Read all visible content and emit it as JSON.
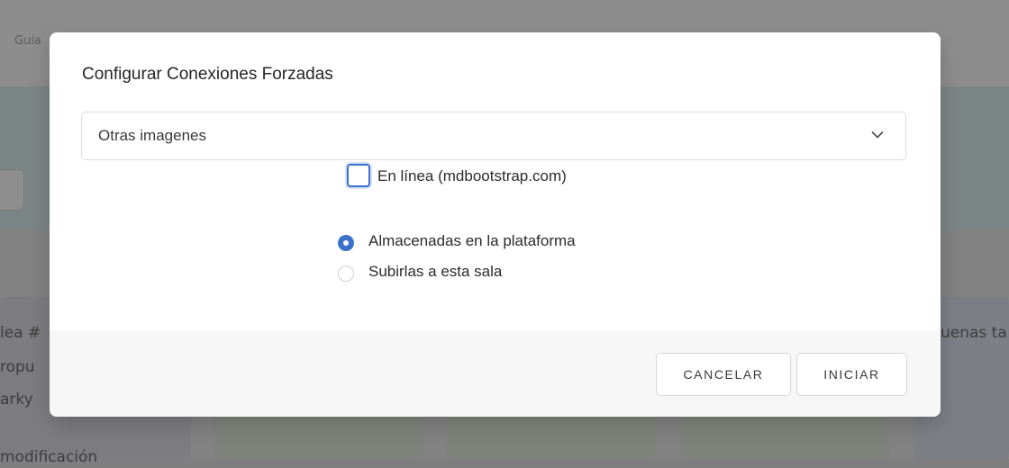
{
  "background": {
    "nav_tab_partial": "Guía",
    "card_texts": [
      "lea #",
      "ropu",
      "arky",
      " modificación",
      "uenas ta"
    ]
  },
  "modal": {
    "title": "Configurar Conexiones Forzadas",
    "select": {
      "value": "Otras imagenes",
      "icon": "chevron-down-icon"
    },
    "checkbox": {
      "label": "En línea (mdbootstrap.com)",
      "checked": false,
      "focused": true
    },
    "radios": [
      {
        "label": "Almacenadas en la plataforma",
        "checked": true
      },
      {
        "label": "Subirlas a esta sala",
        "checked": false
      }
    ],
    "buttons": {
      "cancel": "CANCELAR",
      "start": "INICIAR"
    }
  },
  "colors": {
    "accent": "#3b71ca",
    "overlay": "#8a8a8a",
    "footer": "#f7f7f7"
  }
}
